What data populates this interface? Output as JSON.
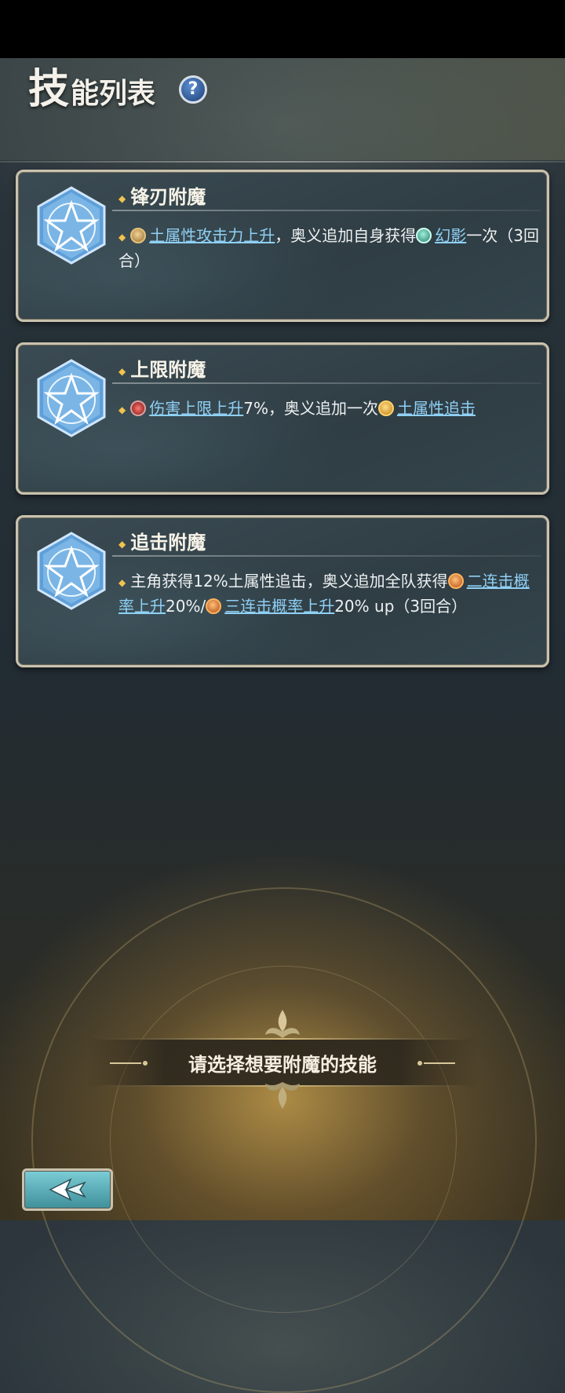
{
  "header": {
    "title_first": "技",
    "title_rest": "能列表",
    "help_label": "?"
  },
  "skills": [
    {
      "name": "锋刃附魔",
      "desc": [
        {
          "type": "link",
          "icon": "earth-attack-icon",
          "text": "土属性攻击力上升"
        },
        {
          "type": "text",
          "text": "，奥义追加自身获得"
        },
        {
          "type": "link",
          "icon": "phantom-icon",
          "text": "幻影"
        },
        {
          "type": "text",
          "text": "一次（3回合）"
        }
      ]
    },
    {
      "name": "上限附魔",
      "desc": [
        {
          "type": "link",
          "icon": "damage-cap-icon",
          "text": "伤害上限上升"
        },
        {
          "type": "text",
          "text": "7%，奥义追加一次"
        },
        {
          "type": "link",
          "icon": "chase-attack-icon",
          "text": "土属性追击"
        }
      ]
    },
    {
      "name": "追击附魔",
      "desc": [
        {
          "type": "text",
          "text": "主角获得12%土属性追击，奥义追加全队获得"
        },
        {
          "type": "link",
          "icon": "double-attack-icon",
          "text": "二连击概率上升"
        },
        {
          "type": "text",
          "text": "20%/"
        },
        {
          "type": "link",
          "icon": "triple-attack-icon",
          "text": "三连击概率上升"
        },
        {
          "type": "text",
          "text": "20% up（3回合）"
        }
      ]
    }
  ],
  "prompt": "请选择想要附魔的技能",
  "back_button": {
    "icon": "back-arrow-icon"
  },
  "colors": {
    "link": "#8fd0f5",
    "bullet": "#f1c34e",
    "frame": "#c9c2ae"
  }
}
